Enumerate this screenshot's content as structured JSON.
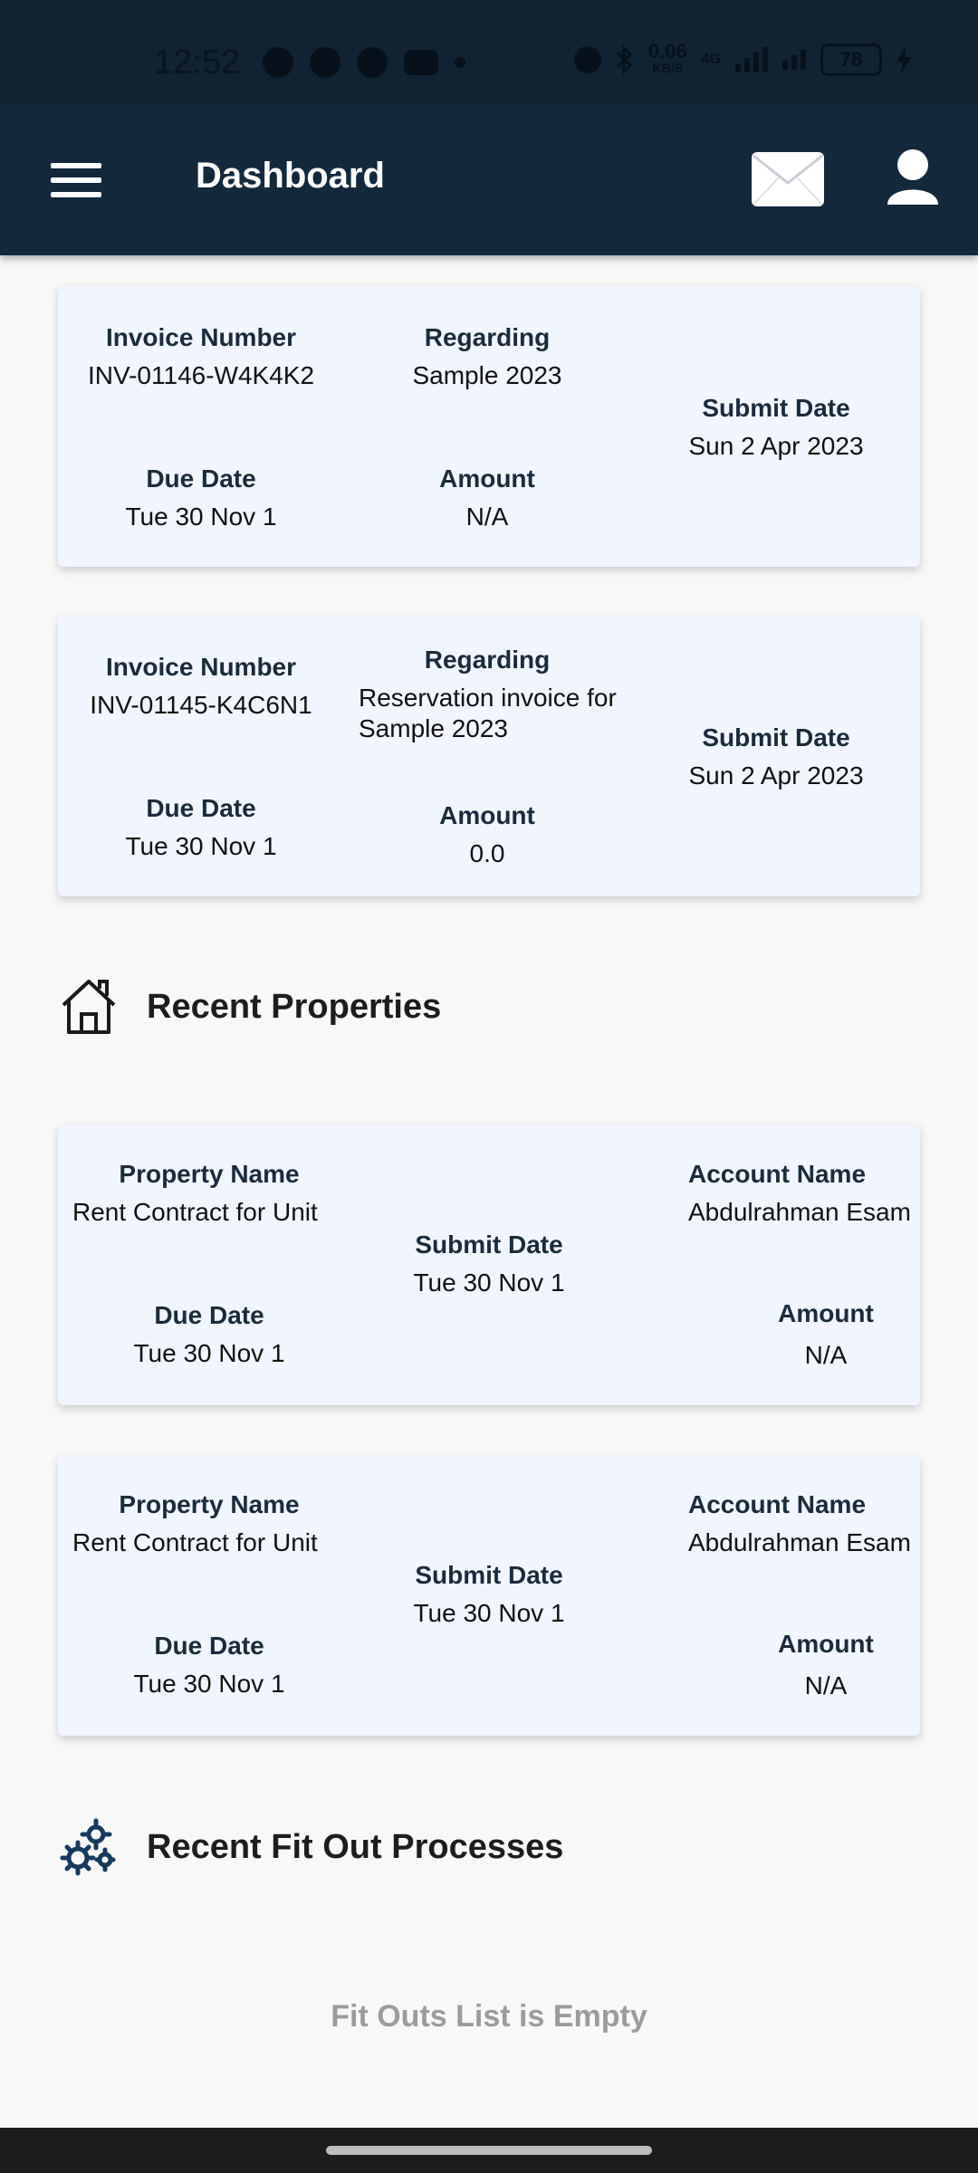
{
  "status_bar": {
    "time": "12:52",
    "data_speed": "0.06",
    "data_unit": "KB/S",
    "network": "4G",
    "battery": "78"
  },
  "app_bar": {
    "title": "Dashboard",
    "menu_icon": "hamburger-menu-icon",
    "mail_icon": "envelope-icon",
    "profile_icon": "user-icon"
  },
  "invoices": [
    {
      "invoice_label": "Invoice Number",
      "invoice_value": "INV-01146-W4K4K2",
      "regarding_label": "Regarding",
      "regarding_value": "Sample 2023",
      "submit_label": "Submit Date",
      "submit_value": "Sun 2 Apr 2023",
      "due_label": "Due Date",
      "due_value": "Tue 30 Nov 1",
      "amount_label": "Amount",
      "amount_value": "N/A"
    },
    {
      "invoice_label": "Invoice Number",
      "invoice_value": "INV-01145-K4C6N1",
      "regarding_label": "Regarding",
      "regarding_value": "Reservation invoice for Sample 2023",
      "submit_label": "Submit Date",
      "submit_value": "Sun 2 Apr 2023",
      "due_label": "Due Date",
      "due_value": "Tue 30 Nov 1",
      "amount_label": "Amount",
      "amount_value": "0.0"
    }
  ],
  "recent_properties": {
    "title": "Recent Properties",
    "icon": "house-icon",
    "items": [
      {
        "property_label": "Property Name",
        "property_value": "Rent Contract for Unit",
        "account_label": "Account Name",
        "account_value": "Abdulrahman Esam",
        "submit_label": "Submit Date",
        "submit_value": "Tue 30 Nov 1",
        "due_label": "Due Date",
        "due_value": "Tue 30 Nov 1",
        "amount_label": "Amount",
        "amount_value": "N/A"
      },
      {
        "property_label": "Property Name",
        "property_value": "Rent Contract for Unit",
        "account_label": "Account Name",
        "account_value": "Abdulrahman Esam",
        "submit_label": "Submit Date",
        "submit_value": "Tue 30 Nov 1",
        "due_label": "Due Date",
        "due_value": "Tue 30 Nov 1",
        "amount_label": "Amount",
        "amount_value": "N/A"
      }
    ]
  },
  "fit_out": {
    "title": "Recent Fit Out Processes",
    "icon": "gears-icon",
    "empty_message": "Fit Outs List is Empty"
  },
  "colors": {
    "app_bar": "#13283b",
    "card_bg": "#f1f5fd",
    "icon_accent": "#163a5c"
  }
}
